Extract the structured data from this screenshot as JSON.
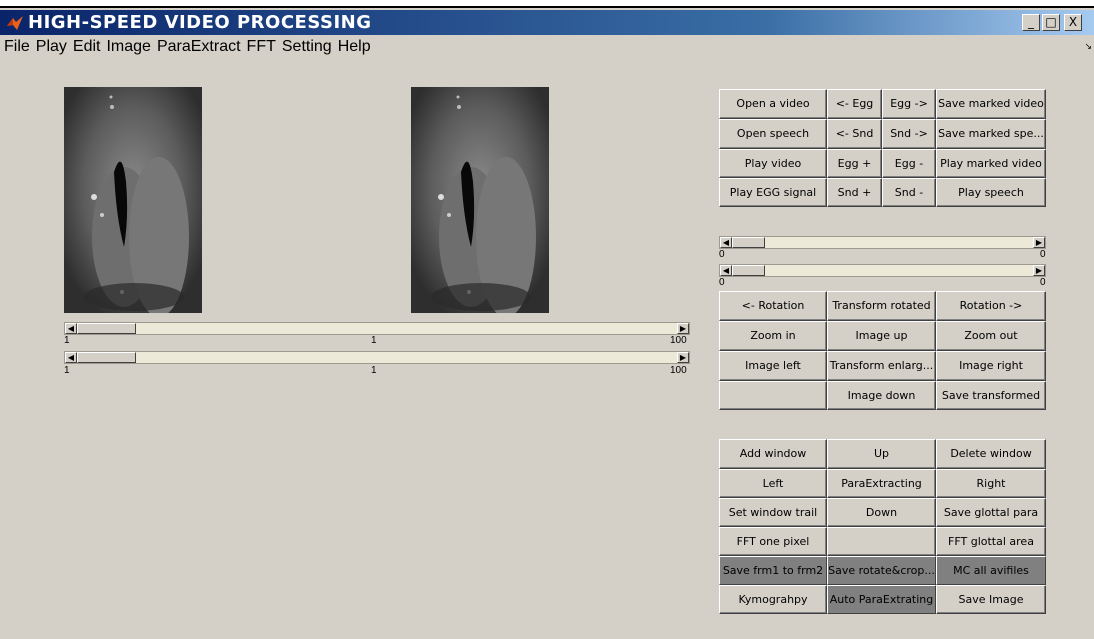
{
  "window": {
    "title": "HIGH-SPEED VIDEO PROCESSING",
    "controls": [
      "_",
      "□",
      "X"
    ]
  },
  "menu": [
    "File",
    "Play",
    "Edit",
    "Image",
    "ParaExtract",
    "FFT",
    "Setting",
    "Help"
  ],
  "video_sliders": [
    {
      "min": "1",
      "mid": "1",
      "max": "100",
      "value": 1
    },
    {
      "min": "1",
      "mid": "1",
      "max": "100",
      "value": 1
    }
  ],
  "right_sliders": [
    {
      "min": "0",
      "max": "0",
      "value": 0
    },
    {
      "min": "0",
      "max": "0",
      "value": 0
    }
  ],
  "button_groups": {
    "media": [
      [
        "Open a video",
        "<- Egg",
        "Egg ->",
        "Save marked video"
      ],
      [
        "Open speech",
        "<- Snd",
        "Snd ->",
        "Save marked spe..."
      ],
      [
        "Play video",
        "Egg +",
        "Egg -",
        "Play marked video"
      ],
      [
        "Play EGG signal",
        "Snd +",
        "Snd -",
        "Play speech"
      ]
    ],
    "transform": [
      [
        "<- Rotation",
        "Transform rotated",
        "Rotation ->"
      ],
      [
        "Zoom in",
        "Image up",
        "Zoom out"
      ],
      [
        "Image left",
        "Transform enlarg...",
        "Image right"
      ],
      [
        "",
        "Image down",
        "Save transformed"
      ]
    ],
    "window": [
      [
        "Add window",
        "Up",
        "Delete window"
      ],
      [
        "Left",
        "ParaExtracting",
        "Right"
      ],
      [
        "Set window trail",
        "Down",
        "Save glottal para"
      ],
      [
        "FFT one pixel",
        "",
        "FFT glottal area"
      ],
      [
        "Save frm1 to frm2",
        "Save rotate&crop...",
        "MC all avifiles"
      ],
      [
        "Kymograhpy",
        "Auto ParaExtrating",
        "Save Image"
      ]
    ]
  },
  "colors": {
    "background": "#d4d0c8",
    "titlebar": "#0a246a",
    "dark_button": "#808080"
  }
}
